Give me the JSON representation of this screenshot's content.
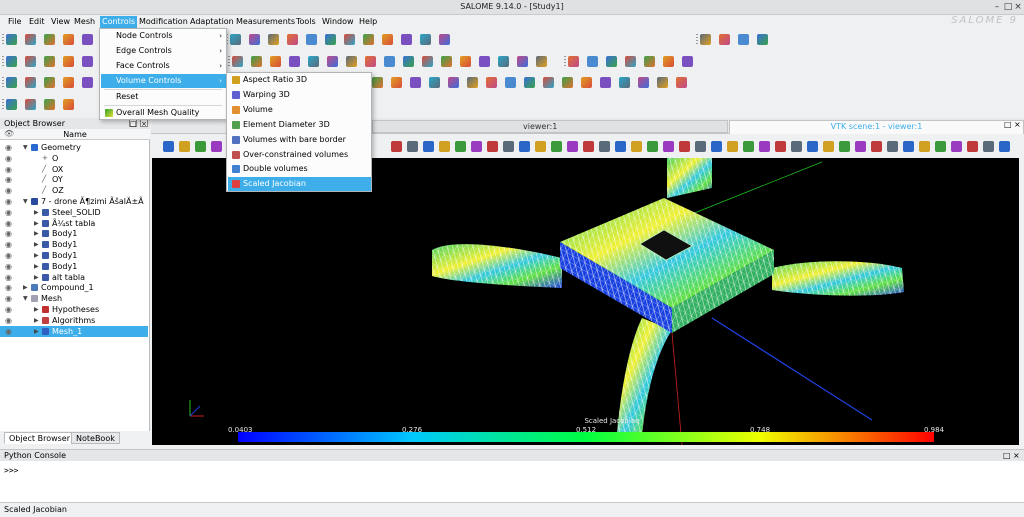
{
  "window": {
    "title": "SALOME 9.14.0 - [Study1]",
    "brand": "SALOME 9",
    "controls": [
      "–",
      "□",
      "×"
    ]
  },
  "menubar": [
    "File",
    "Edit",
    "View",
    "Mesh",
    "Controls",
    "Modification",
    "Adaptation",
    "Measurements",
    "Tools",
    "Window",
    "Help"
  ],
  "controls_menu": {
    "items": [
      "Node Controls",
      "Edge Controls",
      "Face Controls",
      "Volume Controls",
      "Reset",
      "Overall Mesh Quality"
    ],
    "submenu_arrow": "›"
  },
  "volume_menu": {
    "items": [
      "Aspect Ratio 3D",
      "Warping 3D",
      "Volume",
      "Element Diameter 3D",
      "Volumes with bare border",
      "Over-constrained volumes",
      "Double volumes",
      "Scaled Jacobian"
    ]
  },
  "object_browser": {
    "title": "Object Browser",
    "column": "Name",
    "panel_controls": [
      "□",
      "×"
    ],
    "rows": [
      {
        "label": "Geometry",
        "icon": "geometry-icon"
      },
      {
        "label": "O",
        "icon": "point-icon"
      },
      {
        "label": "OX",
        "icon": "axis-icon"
      },
      {
        "label": "OY",
        "icon": "axis-icon"
      },
      {
        "label": "OZ",
        "icon": "axis-icon"
      },
      {
        "label": "7 - drone Ã¶zimi ÃšalÄ±Ã",
        "icon": "part-icon"
      },
      {
        "label": "Steel_SOLID",
        "icon": "solid-icon"
      },
      {
        "label": "Ã¼st tabla",
        "icon": "solid-icon"
      },
      {
        "label": "Body1",
        "icon": "solid-icon"
      },
      {
        "label": "Body1",
        "icon": "solid-icon"
      },
      {
        "label": "Body1",
        "icon": "solid-icon"
      },
      {
        "label": "Body1",
        "icon": "solid-icon"
      },
      {
        "label": "alt tabla",
        "icon": "solid-icon"
      },
      {
        "label": "Compound_1",
        "icon": "compound-icon"
      },
      {
        "label": "Mesh",
        "icon": "mesh-icon"
      },
      {
        "label": "Hypotheses",
        "icon": "hypotheses-icon"
      },
      {
        "label": "Algorithms",
        "icon": "algorithms-icon"
      },
      {
        "label": "Mesh_1",
        "icon": "mesh-object-icon"
      }
    ],
    "tabs": [
      "Object Browser",
      "NoteBook"
    ]
  },
  "viewer": {
    "inactive_tab": "viewer:1",
    "active_tab": "VTK scene:1 - viewer:1",
    "scalar_bar_title": "Scaled Jacobian",
    "scale_ticks": [
      "0.0403",
      "0.276",
      "0.512",
      "0.748",
      "0.984"
    ]
  },
  "python_console": {
    "title": "Python Console",
    "prompt": ">>>"
  },
  "status_bar": {
    "text": "Scaled Jacobian"
  }
}
